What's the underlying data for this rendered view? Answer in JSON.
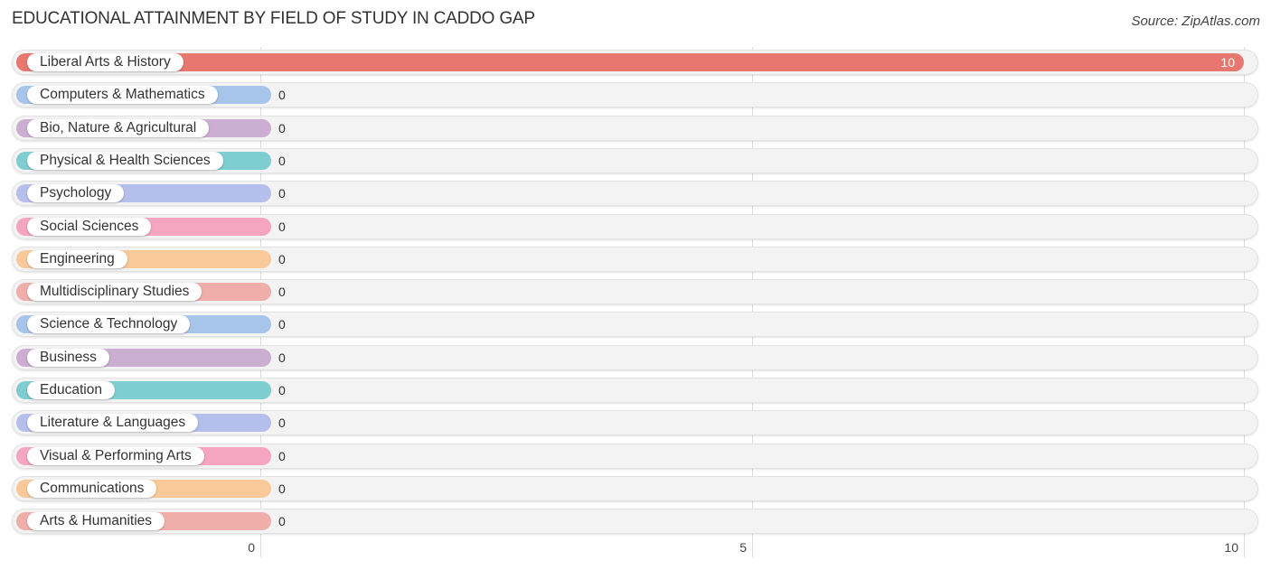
{
  "chart_data": {
    "type": "bar",
    "orientation": "horizontal",
    "title": "EDUCATIONAL ATTAINMENT BY FIELD OF STUDY IN CADDO GAP",
    "source": "Source: ZipAtlas.com",
    "xlabel": "",
    "ylabel": "",
    "xlim": [
      0,
      10
    ],
    "xticks": [
      0,
      5,
      10
    ],
    "xtick_labels": [
      "0",
      "5",
      "10"
    ],
    "grid": true,
    "categories": [
      "Liberal Arts & History",
      "Computers & Mathematics",
      "Bio, Nature & Agricultural",
      "Physical & Health Sciences",
      "Psychology",
      "Social Sciences",
      "Engineering",
      "Multidisciplinary Studies",
      "Science & Technology",
      "Business",
      "Education",
      "Literature & Languages",
      "Visual & Performing Arts",
      "Communications",
      "Arts & Humanities"
    ],
    "values": [
      10,
      0,
      0,
      0,
      0,
      0,
      0,
      0,
      0,
      0,
      0,
      0,
      0,
      0,
      0
    ],
    "value_labels": [
      "10",
      "0",
      "0",
      "0",
      "0",
      "0",
      "0",
      "0",
      "0",
      "0",
      "0",
      "0",
      "0",
      "0",
      "0"
    ],
    "colors": [
      "#e8776f",
      "#a7c4ea",
      "#cbaed2",
      "#7ecdd0",
      "#b5bfec",
      "#f6a5c1",
      "#fac99a",
      "#f0aeab",
      "#a7c4ea",
      "#cbaed2",
      "#7ecdd0",
      "#b5bfec",
      "#f6a5c1",
      "#fac99a",
      "#f0aeab"
    ]
  }
}
